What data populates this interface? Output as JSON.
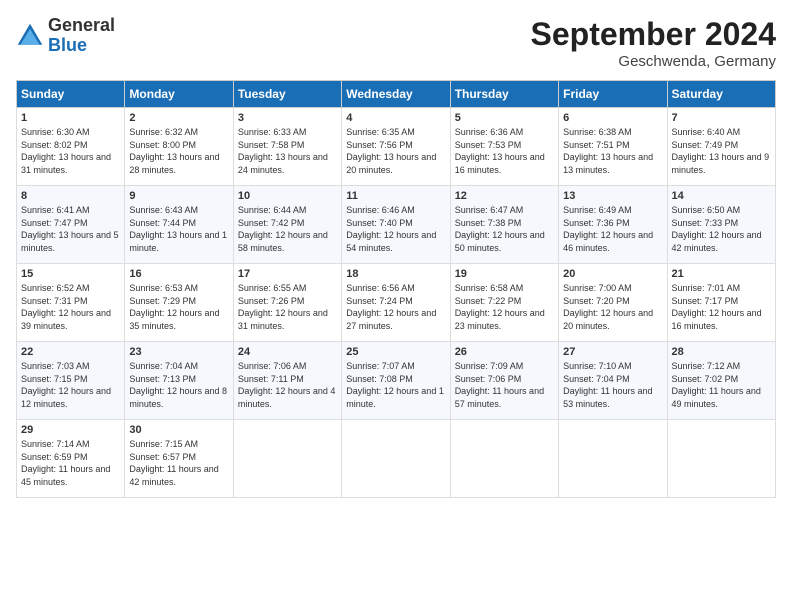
{
  "header": {
    "logo_general": "General",
    "logo_blue": "Blue",
    "month_title": "September 2024",
    "location": "Geschwenda, Germany"
  },
  "days_of_week": [
    "Sunday",
    "Monday",
    "Tuesday",
    "Wednesday",
    "Thursday",
    "Friday",
    "Saturday"
  ],
  "weeks": [
    [
      {
        "day": "1",
        "sunrise": "Sunrise: 6:30 AM",
        "sunset": "Sunset: 8:02 PM",
        "daylight": "Daylight: 13 hours and 31 minutes."
      },
      {
        "day": "2",
        "sunrise": "Sunrise: 6:32 AM",
        "sunset": "Sunset: 8:00 PM",
        "daylight": "Daylight: 13 hours and 28 minutes."
      },
      {
        "day": "3",
        "sunrise": "Sunrise: 6:33 AM",
        "sunset": "Sunset: 7:58 PM",
        "daylight": "Daylight: 13 hours and 24 minutes."
      },
      {
        "day": "4",
        "sunrise": "Sunrise: 6:35 AM",
        "sunset": "Sunset: 7:56 PM",
        "daylight": "Daylight: 13 hours and 20 minutes."
      },
      {
        "day": "5",
        "sunrise": "Sunrise: 6:36 AM",
        "sunset": "Sunset: 7:53 PM",
        "daylight": "Daylight: 13 hours and 16 minutes."
      },
      {
        "day": "6",
        "sunrise": "Sunrise: 6:38 AM",
        "sunset": "Sunset: 7:51 PM",
        "daylight": "Daylight: 13 hours and 13 minutes."
      },
      {
        "day": "7",
        "sunrise": "Sunrise: 6:40 AM",
        "sunset": "Sunset: 7:49 PM",
        "daylight": "Daylight: 13 hours and 9 minutes."
      }
    ],
    [
      {
        "day": "8",
        "sunrise": "Sunrise: 6:41 AM",
        "sunset": "Sunset: 7:47 PM",
        "daylight": "Daylight: 13 hours and 5 minutes."
      },
      {
        "day": "9",
        "sunrise": "Sunrise: 6:43 AM",
        "sunset": "Sunset: 7:44 PM",
        "daylight": "Daylight: 13 hours and 1 minute."
      },
      {
        "day": "10",
        "sunrise": "Sunrise: 6:44 AM",
        "sunset": "Sunset: 7:42 PM",
        "daylight": "Daylight: 12 hours and 58 minutes."
      },
      {
        "day": "11",
        "sunrise": "Sunrise: 6:46 AM",
        "sunset": "Sunset: 7:40 PM",
        "daylight": "Daylight: 12 hours and 54 minutes."
      },
      {
        "day": "12",
        "sunrise": "Sunrise: 6:47 AM",
        "sunset": "Sunset: 7:38 PM",
        "daylight": "Daylight: 12 hours and 50 minutes."
      },
      {
        "day": "13",
        "sunrise": "Sunrise: 6:49 AM",
        "sunset": "Sunset: 7:36 PM",
        "daylight": "Daylight: 12 hours and 46 minutes."
      },
      {
        "day": "14",
        "sunrise": "Sunrise: 6:50 AM",
        "sunset": "Sunset: 7:33 PM",
        "daylight": "Daylight: 12 hours and 42 minutes."
      }
    ],
    [
      {
        "day": "15",
        "sunrise": "Sunrise: 6:52 AM",
        "sunset": "Sunset: 7:31 PM",
        "daylight": "Daylight: 12 hours and 39 minutes."
      },
      {
        "day": "16",
        "sunrise": "Sunrise: 6:53 AM",
        "sunset": "Sunset: 7:29 PM",
        "daylight": "Daylight: 12 hours and 35 minutes."
      },
      {
        "day": "17",
        "sunrise": "Sunrise: 6:55 AM",
        "sunset": "Sunset: 7:26 PM",
        "daylight": "Daylight: 12 hours and 31 minutes."
      },
      {
        "day": "18",
        "sunrise": "Sunrise: 6:56 AM",
        "sunset": "Sunset: 7:24 PM",
        "daylight": "Daylight: 12 hours and 27 minutes."
      },
      {
        "day": "19",
        "sunrise": "Sunrise: 6:58 AM",
        "sunset": "Sunset: 7:22 PM",
        "daylight": "Daylight: 12 hours and 23 minutes."
      },
      {
        "day": "20",
        "sunrise": "Sunrise: 7:00 AM",
        "sunset": "Sunset: 7:20 PM",
        "daylight": "Daylight: 12 hours and 20 minutes."
      },
      {
        "day": "21",
        "sunrise": "Sunrise: 7:01 AM",
        "sunset": "Sunset: 7:17 PM",
        "daylight": "Daylight: 12 hours and 16 minutes."
      }
    ],
    [
      {
        "day": "22",
        "sunrise": "Sunrise: 7:03 AM",
        "sunset": "Sunset: 7:15 PM",
        "daylight": "Daylight: 12 hours and 12 minutes."
      },
      {
        "day": "23",
        "sunrise": "Sunrise: 7:04 AM",
        "sunset": "Sunset: 7:13 PM",
        "daylight": "Daylight: 12 hours and 8 minutes."
      },
      {
        "day": "24",
        "sunrise": "Sunrise: 7:06 AM",
        "sunset": "Sunset: 7:11 PM",
        "daylight": "Daylight: 12 hours and 4 minutes."
      },
      {
        "day": "25",
        "sunrise": "Sunrise: 7:07 AM",
        "sunset": "Sunset: 7:08 PM",
        "daylight": "Daylight: 12 hours and 1 minute."
      },
      {
        "day": "26",
        "sunrise": "Sunrise: 7:09 AM",
        "sunset": "Sunset: 7:06 PM",
        "daylight": "Daylight: 11 hours and 57 minutes."
      },
      {
        "day": "27",
        "sunrise": "Sunrise: 7:10 AM",
        "sunset": "Sunset: 7:04 PM",
        "daylight": "Daylight: 11 hours and 53 minutes."
      },
      {
        "day": "28",
        "sunrise": "Sunrise: 7:12 AM",
        "sunset": "Sunset: 7:02 PM",
        "daylight": "Daylight: 11 hours and 49 minutes."
      }
    ],
    [
      {
        "day": "29",
        "sunrise": "Sunrise: 7:14 AM",
        "sunset": "Sunset: 6:59 PM",
        "daylight": "Daylight: 11 hours and 45 minutes."
      },
      {
        "day": "30",
        "sunrise": "Sunrise: 7:15 AM",
        "sunset": "Sunset: 6:57 PM",
        "daylight": "Daylight: 11 hours and 42 minutes."
      },
      null,
      null,
      null,
      null,
      null
    ]
  ]
}
